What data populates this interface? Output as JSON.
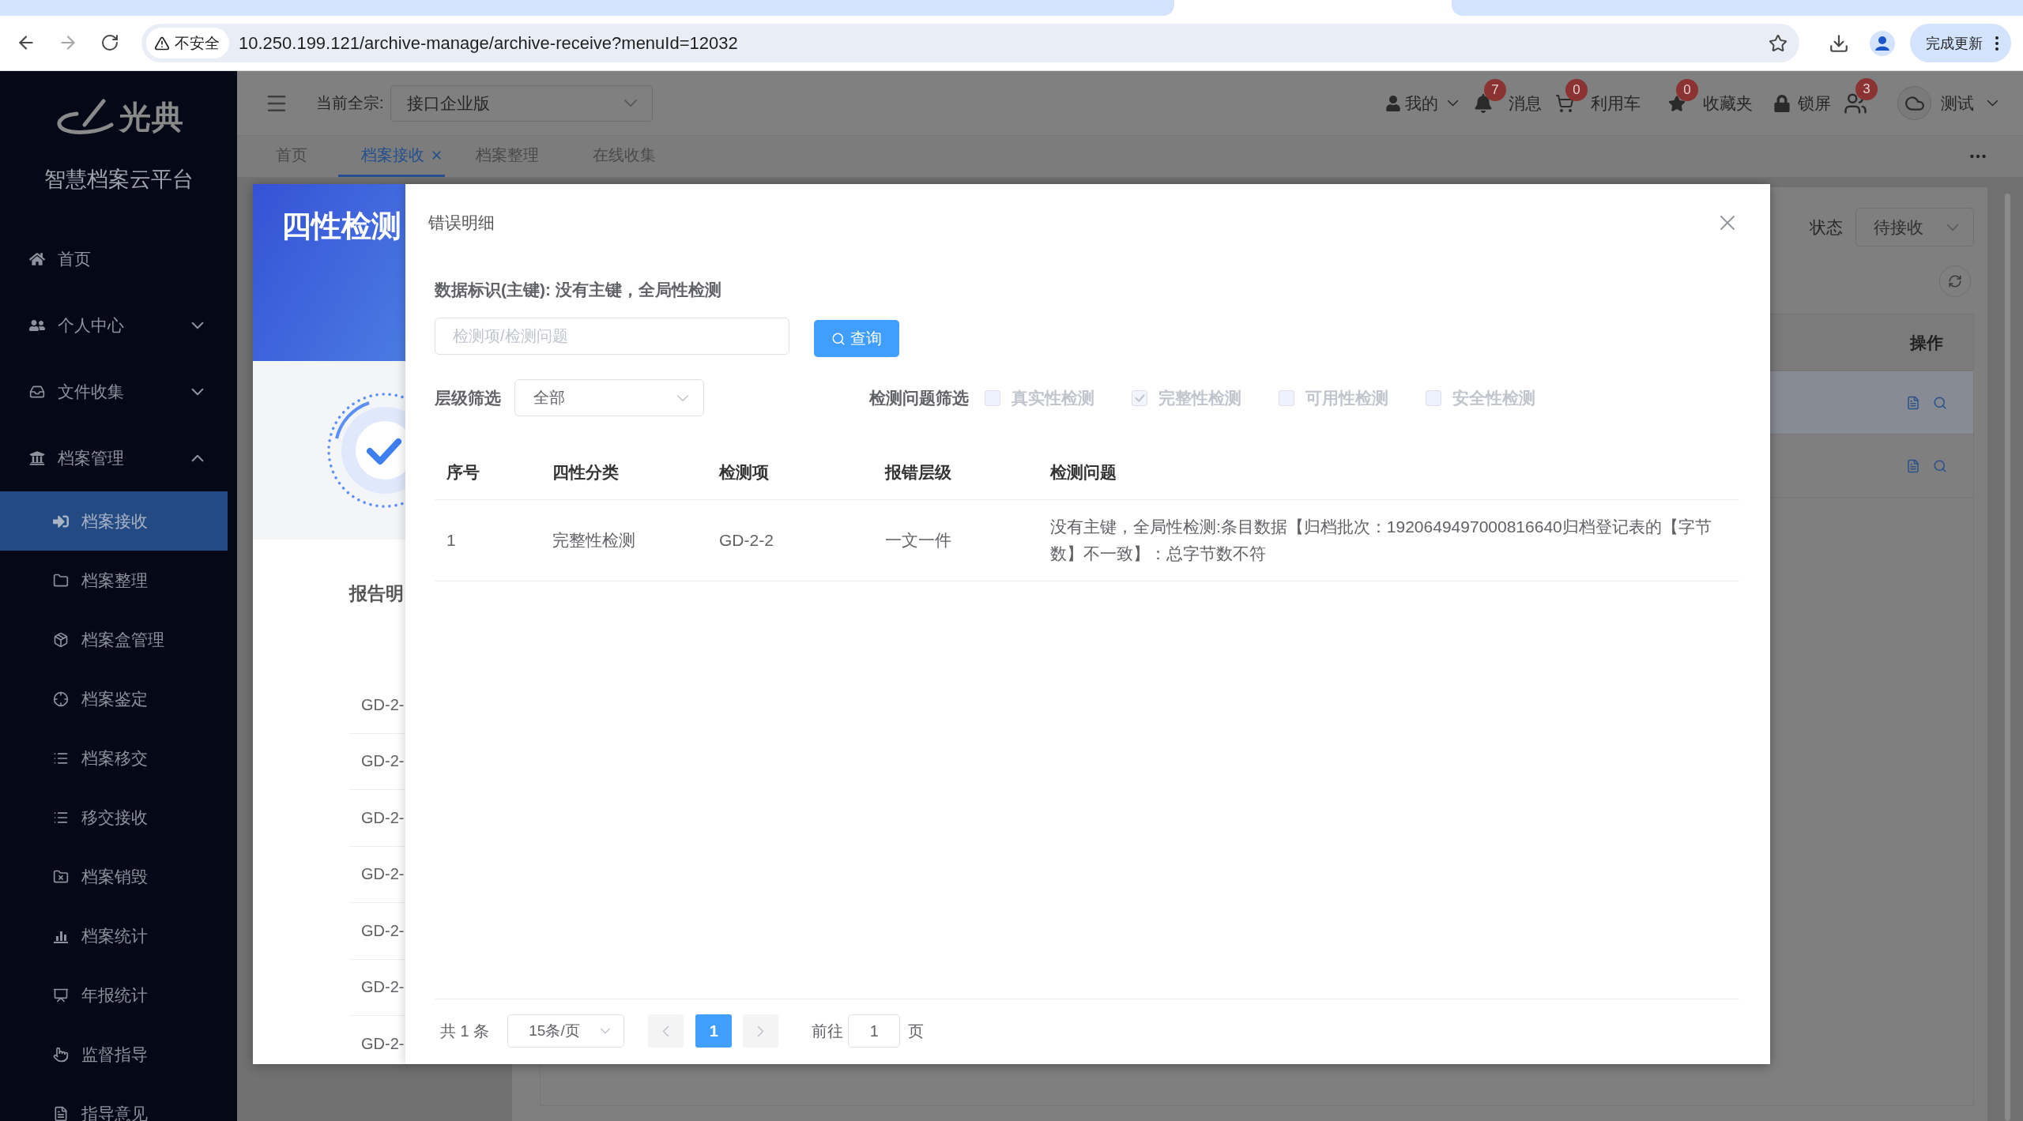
{
  "browser": {
    "security_label": "不安全",
    "url": "10.250.199.121/archive-manage/archive-receive?menuId=12032",
    "update_button": "完成更新"
  },
  "sidebar": {
    "logo_text": "光典",
    "platform_name": "智慧档案云平台",
    "items": [
      {
        "label": "首页",
        "selected": false
      },
      {
        "label": "个人中心",
        "selected": false,
        "expanded": false
      },
      {
        "label": "文件收集",
        "selected": false,
        "expanded": false
      },
      {
        "label": "档案管理",
        "selected": false,
        "expanded": true,
        "children": [
          {
            "label": "档案接收",
            "selected": true
          },
          {
            "label": "档案整理",
            "selected": false
          },
          {
            "label": "档案盒管理",
            "selected": false
          },
          {
            "label": "档案鉴定",
            "selected": false
          },
          {
            "label": "档案移交",
            "selected": false
          },
          {
            "label": "移交接收",
            "selected": false
          },
          {
            "label": "档案销毁",
            "selected": false
          },
          {
            "label": "档案统计",
            "selected": false
          },
          {
            "label": "年报统计",
            "selected": false
          },
          {
            "label": "监督指导",
            "selected": false
          },
          {
            "label": "指导意见",
            "selected": false
          }
        ]
      }
    ]
  },
  "header": {
    "fonds_label": "当前全宗:",
    "fonds_value": "接口企业版",
    "user_menu": "我的",
    "actions": [
      {
        "label": "消息",
        "badge": "7"
      },
      {
        "label": "利用车",
        "badge": "0"
      },
      {
        "label": "收藏夹",
        "badge": "0"
      },
      {
        "label": "锁屏"
      },
      {
        "badge": "3"
      }
    ],
    "account": "测试"
  },
  "tabs": [
    {
      "label": "首页",
      "selected": false,
      "closable": false
    },
    {
      "label": "档案接收",
      "selected": true,
      "closable": true
    },
    {
      "label": "档案整理",
      "selected": false,
      "closable": false
    },
    {
      "label": "在线收集",
      "selected": false,
      "closable": false
    }
  ],
  "page": {
    "status_filter": {
      "label": "状态",
      "value": "待接收"
    },
    "table": {
      "columns": [
        "操作"
      ],
      "rows": [
        {
          "selected": true
        },
        {
          "selected": false
        }
      ]
    }
  },
  "report_dialog": {
    "title": "四性检测",
    "section_title": "报告明",
    "items": [
      "GD-2-",
      "GD-2-",
      "GD-2-",
      "GD-2-",
      "GD-2-",
      "GD-2-",
      "GD-2-"
    ]
  },
  "error_dialog": {
    "title": "错误明细",
    "data_id": "数据标识(主键): 没有主键，全局性检测",
    "search": {
      "placeholder": "检测项/检测问题"
    },
    "search_button": "查询",
    "level_filter": {
      "label": "层级筛选",
      "value": "全部"
    },
    "issue_filter": {
      "label": "检测问题筛选",
      "options": [
        {
          "label": "真实性检测",
          "checked": false,
          "disabled": true
        },
        {
          "label": "完整性检测",
          "checked": true,
          "disabled": true
        },
        {
          "label": "可用性检测",
          "checked": false,
          "disabled": true
        },
        {
          "label": "安全性检测",
          "checked": false,
          "disabled": true
        }
      ]
    },
    "table": {
      "columns": [
        "序号",
        "四性分类",
        "检测项",
        "报错层级",
        "检测问题"
      ],
      "rows": [
        [
          "1",
          "完整性检测",
          "GD-2-2",
          "一文一件",
          "没有主键，全局性检测:条目数据【归档批次：1920649497000816640归档登记表的【字节数】不一致】：总字节数不符"
        ]
      ]
    },
    "pagination": {
      "total": "共 1 条",
      "page_size": "15条/页",
      "pages": [
        {
          "label": "1",
          "selected": true
        }
      ],
      "jump_label": "前往",
      "jump_value": "1",
      "jump_suffix": "页"
    }
  }
}
